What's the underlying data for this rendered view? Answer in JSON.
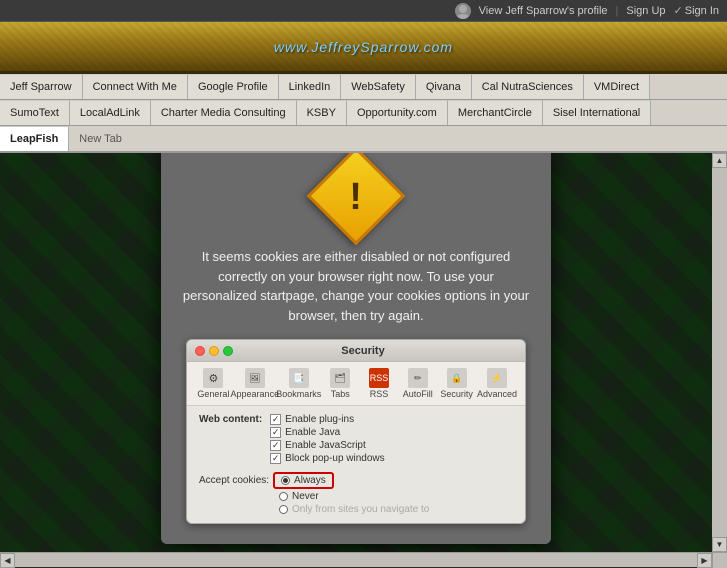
{
  "topbar": {
    "profile_link": "View Jeff Sparrow's profile",
    "signup_label": "Sign Up",
    "signin_label": "Sign In"
  },
  "header": {
    "url": "www.JeffreySparrow.com"
  },
  "nav": {
    "row1": [
      "Jeff Sparrow",
      "Connect With Me",
      "Google Profile",
      "LinkedIn",
      "WebSafety",
      "Qivana",
      "Cal NutraSciences",
      "VMDirect"
    ],
    "row2": [
      "SumoText",
      "LocalAdLink",
      "Charter Media Consulting",
      "KSBY",
      "Opportunity.com",
      "MerchantCircle",
      "Sisel International"
    ],
    "row3_active": "LeapFish",
    "row3_new_tab": "New Tab"
  },
  "warning": {
    "message": "It seems cookies are either disabled or not configured correctly on your browser right now. To use your personalized startpage, change your cookies options in your browser, then try again.",
    "exclaim": "!"
  },
  "security": {
    "title": "Security",
    "toolbar": [
      {
        "label": "General",
        "icon": "⚙"
      },
      {
        "label": "Appearance",
        "icon": "🖼"
      },
      {
        "label": "Bookmarks",
        "icon": "📑"
      },
      {
        "label": "Tabs",
        "icon": "🗂"
      },
      {
        "label": "RSS",
        "icon": "📡"
      },
      {
        "label": "AutoFill",
        "icon": "✏"
      },
      {
        "label": "Security",
        "icon": "🔒"
      },
      {
        "label": "Advanced",
        "icon": "⚡"
      }
    ],
    "web_content_label": "Web content:",
    "checkboxes": [
      {
        "label": "Enable plug-ins",
        "checked": true
      },
      {
        "label": "Enable Java",
        "checked": true
      },
      {
        "label": "Enable JavaScript",
        "checked": true
      },
      {
        "label": "Block pop-up windows",
        "checked": true
      }
    ],
    "accept_cookies_label": "Accept cookies:",
    "always_label": "Always",
    "never_label": "Never",
    "only_from_label": "Only from sites you navigate to"
  },
  "scrollbar": {
    "up_arrow": "▲",
    "down_arrow": "▼",
    "left_arrow": "◀",
    "right_arrow": "▶"
  }
}
